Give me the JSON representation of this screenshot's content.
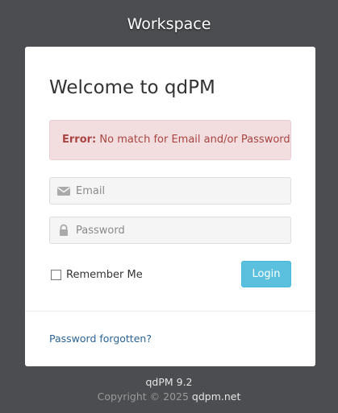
{
  "header": {
    "brand": "Workspace"
  },
  "login": {
    "title": "Welcome to qdPM",
    "error": {
      "label": "Error:",
      "message": "No match for Email and/or Password"
    },
    "email": {
      "placeholder": "Email",
      "value": "",
      "icon": "envelope-icon"
    },
    "password": {
      "placeholder": "Password",
      "value": "",
      "icon": "lock-icon"
    },
    "remember_label": "Remember Me",
    "remember_checked": false,
    "login_label": "Login",
    "forgot_label": "Password forgotten?"
  },
  "footer": {
    "version": "qdPM 9.2",
    "copyright": "Copyright © 2025",
    "link": "qdpm.net"
  },
  "colors": {
    "background": "#4b4d50",
    "accent": "#5bc0de",
    "error_bg": "#f2dede",
    "error_text": "#a94442",
    "link": "#2a6496"
  }
}
